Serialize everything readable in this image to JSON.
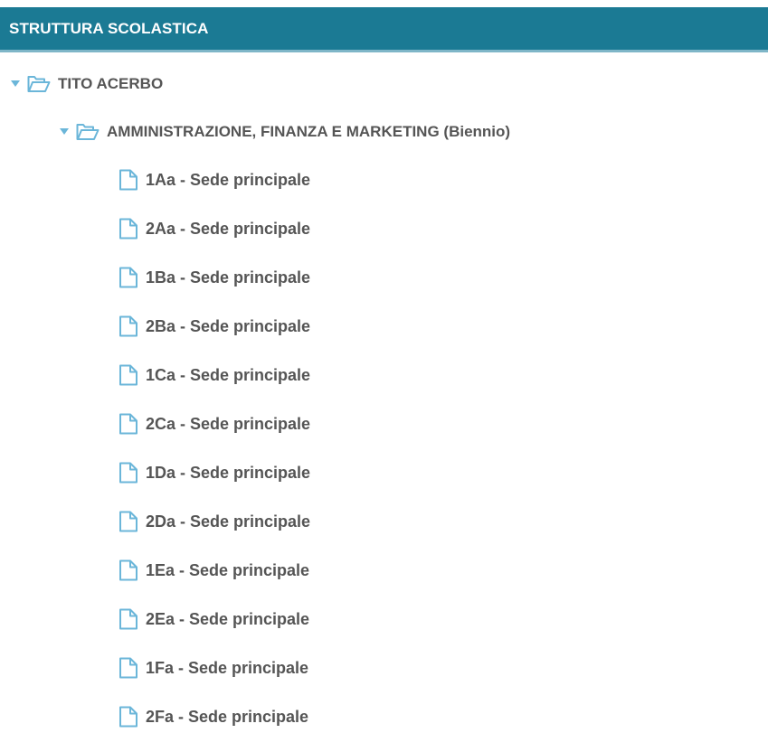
{
  "header": {
    "title": "STRUTTURA SCOLASTICA",
    "color": "#1b7a94"
  },
  "icons": {
    "caret": "caret-down-icon",
    "folder": "folder-open-icon",
    "file": "file-icon",
    "icon_color": "#6bb6d9"
  },
  "tree": {
    "school": {
      "label": "TITO ACERBO",
      "expanded": true
    },
    "course": {
      "label": "AMMINISTRAZIONE, FINANZA E MARKETING (Biennio)",
      "expanded": true
    },
    "classes": [
      "1Aa - Sede principale",
      "2Aa - Sede principale",
      "1Ba - Sede principale",
      "2Ba - Sede principale",
      "1Ca - Sede principale",
      "2Ca - Sede principale",
      "1Da - Sede principale",
      "2Da - Sede principale",
      "1Ea - Sede principale",
      "2Ea - Sede principale",
      "1Fa - Sede principale",
      "2Fa - Sede principale"
    ]
  }
}
